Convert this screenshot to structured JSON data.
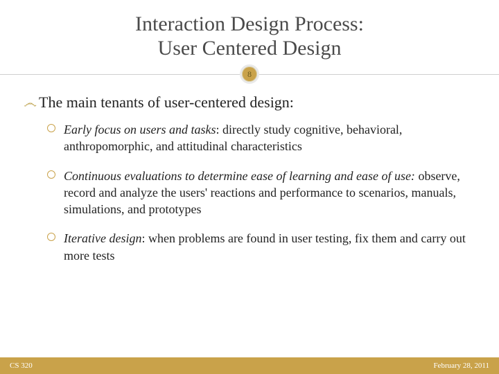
{
  "title": {
    "line1": "Interaction Design Process:",
    "line2": "User Centered Design"
  },
  "page_number": "8",
  "intro": "The main tenants of user-centered design:",
  "bullets": [
    {
      "lead": "Early focus on users and tasks",
      "rest": ": directly study cognitive, behavioral, anthropomorphic, and attitudinal characteristics"
    },
    {
      "lead": "Continuous evaluations to determine ease of learning and ease of use:",
      "rest": "  observe, record and analyze the users' reactions and performance to scenarios, manuals, simulations, and prototypes"
    },
    {
      "lead": "Iterative design",
      "rest": ": when problems are found in user testing, fix them and carry out more tests"
    }
  ],
  "footer": {
    "course": "CS 320",
    "date": "February 28, 2011"
  },
  "colors": {
    "accent": "#c9a24a"
  }
}
